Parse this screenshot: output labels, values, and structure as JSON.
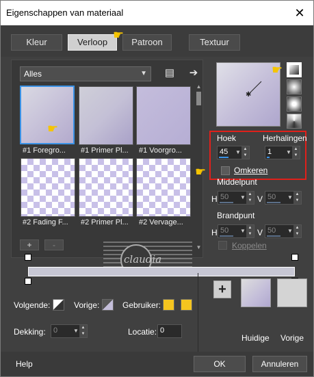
{
  "window": {
    "title": "Eigenschappen van materiaal",
    "close_glyph": "✕"
  },
  "tabs": [
    {
      "label": "Kleur",
      "active": false
    },
    {
      "label": "Verloop",
      "active": true
    },
    {
      "label": "Patroon",
      "active": false
    },
    {
      "label": "Textuur",
      "active": false
    }
  ],
  "library": {
    "category": "Alles",
    "swatches": [
      {
        "caption": "#1 Foregro...",
        "selected": true
      },
      {
        "caption": "#1 Primer Pl...",
        "selected": false
      },
      {
        "caption": "#1 Voorgro...",
        "selected": false
      },
      {
        "caption": "#2 Fading F...",
        "selected": false
      },
      {
        "caption": "#2 Primer Pl...",
        "selected": false
      },
      {
        "caption": "#2 Vervage...",
        "selected": false
      }
    ],
    "add_label": "+",
    "remove_label": "-"
  },
  "gradient": {
    "angle_label": "Hoek",
    "angle_value": "45",
    "repeats_label": "Herhalingen",
    "repeats_value": "1",
    "invert_label": "Omkeren",
    "center_label": "Middelpunt",
    "center_h_label": "H",
    "center_h_value": "50",
    "center_v_label": "V",
    "center_v_value": "50",
    "focal_label": "Brandpunt",
    "focal_h_label": "H",
    "focal_h_value": "50",
    "focal_v_label": "V",
    "focal_v_value": "50",
    "link_label": "Koppelen"
  },
  "bottom": {
    "next_label": "Volgende:",
    "prev_label": "Vorige:",
    "user_label": "Gebruiker:",
    "opacity_label": "Dekking:",
    "opacity_value": "0",
    "location_label": "Locatie:",
    "location_value": "0",
    "current_label": "Huidige",
    "previous_label": "Vorige",
    "add_glyph": "+"
  },
  "watermark_text": "claudia",
  "footer": {
    "help_label": "Help",
    "ok_label": "OK",
    "cancel_label": "Annuleren"
  },
  "colors": {
    "accent_blue": "#3a92e6",
    "user_color": "#f5c51f",
    "current_swatch": "#c3bdd9",
    "previous_swatch": "#d4d4d4",
    "highlight_red": "#e0201a"
  }
}
